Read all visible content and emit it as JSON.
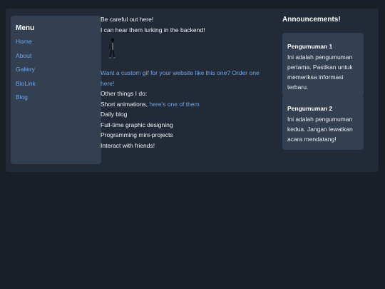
{
  "sidebar": {
    "title": "Menu",
    "items": [
      {
        "label": "Home"
      },
      {
        "label": "About"
      },
      {
        "label": "Gallery"
      },
      {
        "label": "BioLink"
      },
      {
        "label": "Blog"
      }
    ]
  },
  "main": {
    "line1": "Be careful out here!",
    "line2": "I can hear them lurking in the backend!",
    "gif_alt": "animated character gif",
    "order_link": "Want a custom gif for your website like this one? Order one here!",
    "other_things": "Other things I do:",
    "short_animations": "Short animations,",
    "here_link": "here's one of them",
    "items": [
      "Daily blog",
      "Full-time graphic designing",
      "Programming mini-projects",
      "Interact with friends!"
    ]
  },
  "announcements": {
    "title": "Announcements!",
    "cards": [
      {
        "title": "Pengumuman 1",
        "body": "Ini adalah pengumuman pertama. Pastikan untuk memeriksa informasi terbaru."
      },
      {
        "title": "Pengumuman 2",
        "body": "Ini adalah pengumuman kedua. Jangan lewatkan acara mendatang!"
      }
    ]
  },
  "colors": {
    "background": "#1a1e27",
    "panel": "#222a37",
    "card": "#334052",
    "link": "#6fa6e8"
  }
}
